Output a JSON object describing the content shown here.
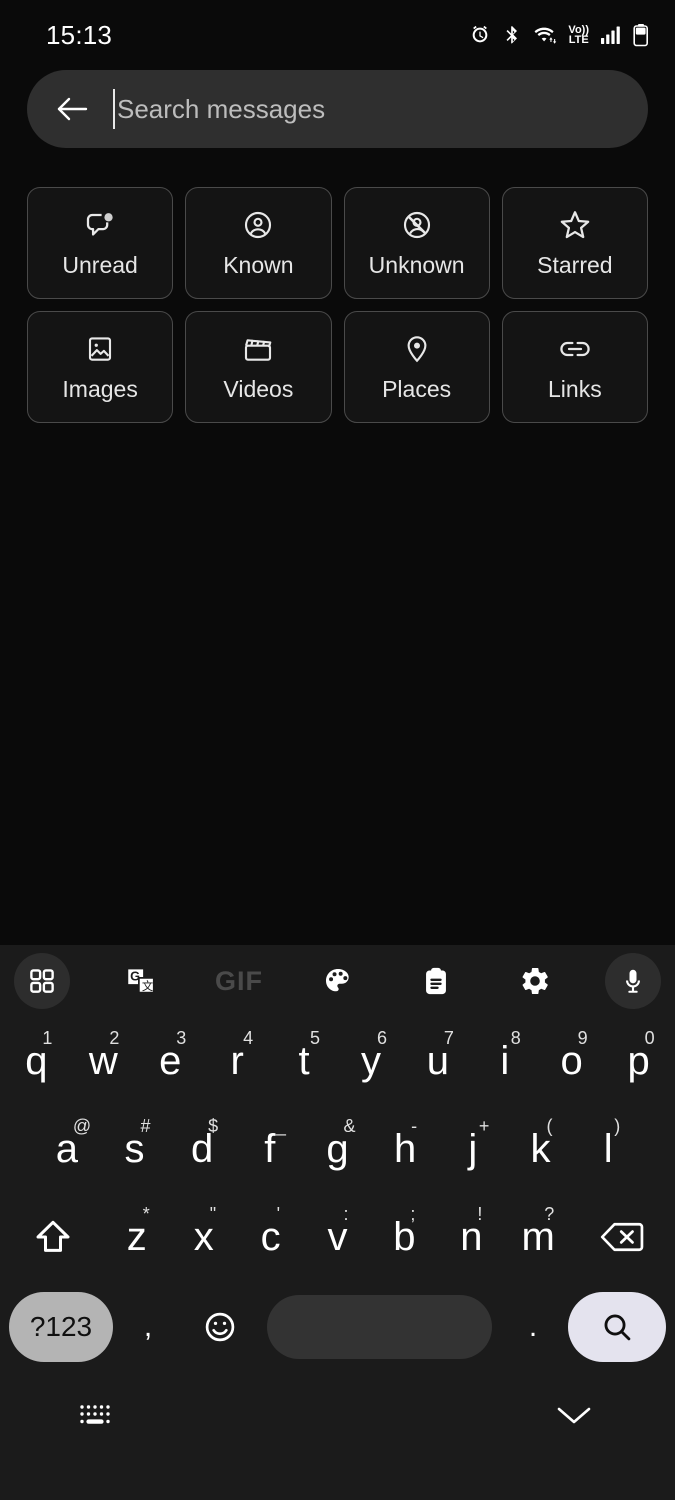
{
  "status_bar": {
    "time": "15:13",
    "network_label_top": "Vo))",
    "network_label_bottom": "LTE",
    "icons": [
      "alarm-icon",
      "bluetooth-icon",
      "wifi-icon",
      "volte-icon",
      "signal-icon",
      "battery-icon"
    ]
  },
  "search": {
    "back_icon": "back-arrow-icon",
    "placeholder": "Search messages",
    "value": ""
  },
  "filters": {
    "rows": [
      [
        {
          "label": "Unread",
          "icon": "unread-bubble-icon"
        },
        {
          "label": "Known",
          "icon": "person-circle-icon"
        },
        {
          "label": "Unknown",
          "icon": "person-blocked-icon"
        },
        {
          "label": "Starred",
          "icon": "star-icon"
        }
      ],
      [
        {
          "label": "Images",
          "icon": "image-icon"
        },
        {
          "label": "Videos",
          "icon": "movie-clapper-icon"
        },
        {
          "label": "Places",
          "icon": "location-pin-icon"
        },
        {
          "label": "Links",
          "icon": "link-chain-icon"
        }
      ]
    ]
  },
  "keyboard": {
    "toolbar": [
      {
        "name": "apps-grid-icon",
        "label": "",
        "circled": true
      },
      {
        "name": "translate-icon",
        "label": ""
      },
      {
        "name": "gif-icon",
        "label": "GIF"
      },
      {
        "name": "palette-icon",
        "label": ""
      },
      {
        "name": "clipboard-icon",
        "label": ""
      },
      {
        "name": "settings-gear-icon",
        "label": ""
      },
      {
        "name": "microphone-icon",
        "label": "",
        "circled": true
      }
    ],
    "row1": [
      {
        "key": "q",
        "sup": "1"
      },
      {
        "key": "w",
        "sup": "2"
      },
      {
        "key": "e",
        "sup": "3"
      },
      {
        "key": "r",
        "sup": "4"
      },
      {
        "key": "t",
        "sup": "5"
      },
      {
        "key": "y",
        "sup": "6"
      },
      {
        "key": "u",
        "sup": "7"
      },
      {
        "key": "i",
        "sup": "8"
      },
      {
        "key": "o",
        "sup": "9"
      },
      {
        "key": "p",
        "sup": "0"
      }
    ],
    "row2": [
      {
        "key": "a",
        "sup": "@"
      },
      {
        "key": "s",
        "sup": "#"
      },
      {
        "key": "d",
        "sup": "$"
      },
      {
        "key": "f",
        "sup": "_"
      },
      {
        "key": "g",
        "sup": "&"
      },
      {
        "key": "h",
        "sup": "-"
      },
      {
        "key": "j",
        "sup": "+"
      },
      {
        "key": "k",
        "sup": "("
      },
      {
        "key": "l",
        "sup": ")"
      }
    ],
    "row3": [
      {
        "key": "z",
        "sup": "*"
      },
      {
        "key": "x",
        "sup": "\""
      },
      {
        "key": "c",
        "sup": "'"
      },
      {
        "key": "v",
        "sup": ":"
      },
      {
        "key": "b",
        "sup": ";"
      },
      {
        "key": "n",
        "sup": "!"
      },
      {
        "key": "m",
        "sup": "?"
      }
    ],
    "shift_icon": "shift-icon",
    "backspace_icon": "backspace-icon",
    "row4": {
      "symbols_label": "?123",
      "comma": ",",
      "emoji_icon": "emoji-smiley-icon",
      "space_label": "",
      "period": ".",
      "search_icon": "search-icon"
    }
  },
  "nav_bar": {
    "keyboard_switch_icon": "keyboard-switch-icon",
    "dismiss_icon": "chevron-down-icon"
  },
  "colors": {
    "background": "#0a0a0a",
    "search_bar": "#2f2f2f",
    "chip_border": "#4a4a4a",
    "keyboard_bg": "#1b1b1b",
    "sym_key": "#b4b4b4",
    "space_key": "#333333",
    "search_key": "#e4e3ee"
  }
}
